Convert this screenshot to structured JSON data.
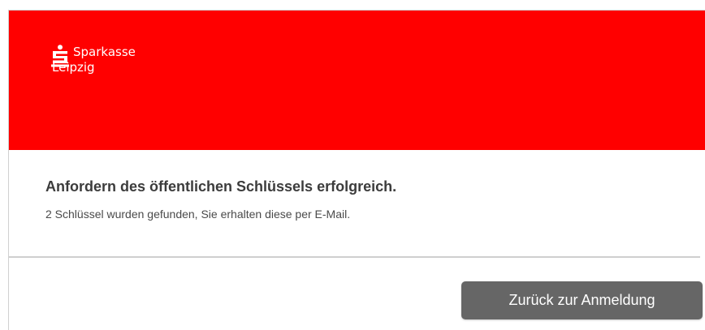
{
  "brand": {
    "name_line1": "Sparkasse",
    "name_line2": "Leipzig",
    "color": "#ff0000",
    "logo_icon": "sparkasse-s-icon"
  },
  "message": {
    "title": "Anfordern des öffentlichen Schlüssels erfolgreich.",
    "body": "2 Schlüssel wurden gefunden, Sie erhalten diese per E-Mail."
  },
  "actions": {
    "back_label": "Zurück zur Anmeldung",
    "back_color": "#666666"
  }
}
